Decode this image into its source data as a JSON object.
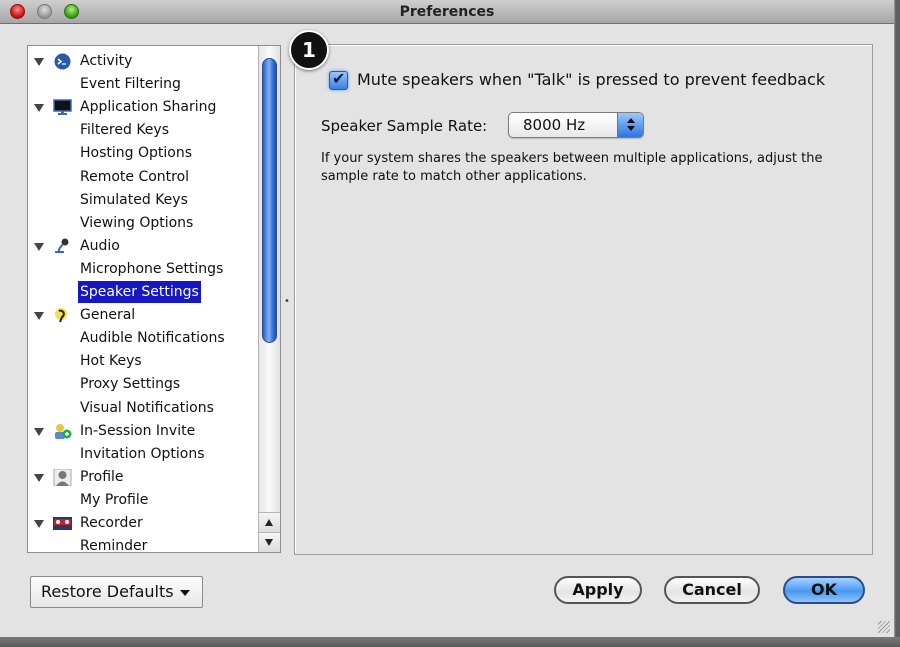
{
  "window": {
    "title": "Preferences"
  },
  "tree": {
    "items": [
      {
        "label": "Activity",
        "type": "parent",
        "icon": "activity-terminal-icon"
      },
      {
        "label": "Event Filtering",
        "type": "child"
      },
      {
        "label": "Application Sharing",
        "type": "parent",
        "icon": "monitor-icon"
      },
      {
        "label": "Filtered Keys",
        "type": "child"
      },
      {
        "label": "Hosting Options",
        "type": "child"
      },
      {
        "label": "Remote Control",
        "type": "child"
      },
      {
        "label": "Simulated Keys",
        "type": "child"
      },
      {
        "label": "Viewing Options",
        "type": "child"
      },
      {
        "label": "Audio",
        "type": "parent",
        "icon": "microphone-icon"
      },
      {
        "label": "Microphone Settings",
        "type": "child"
      },
      {
        "label": "Speaker Settings",
        "type": "child",
        "selected": true
      },
      {
        "label": "General",
        "type": "parent",
        "icon": "general-settings-icon"
      },
      {
        "label": "Audible Notifications",
        "type": "child"
      },
      {
        "label": "Hot Keys",
        "type": "child"
      },
      {
        "label": "Proxy Settings",
        "type": "child"
      },
      {
        "label": "Visual Notifications",
        "type": "child"
      },
      {
        "label": "In-Session Invite",
        "type": "parent",
        "icon": "invite-user-icon"
      },
      {
        "label": "Invitation Options",
        "type": "child"
      },
      {
        "label": "Profile",
        "type": "parent",
        "icon": "profile-silhouette-icon"
      },
      {
        "label": "My Profile",
        "type": "child"
      },
      {
        "label": "Recorder",
        "type": "parent",
        "icon": "recorder-icon"
      },
      {
        "label": "Reminder",
        "type": "child"
      }
    ],
    "selected": "Speaker Settings"
  },
  "callout": {
    "number": "1"
  },
  "speaker_settings": {
    "mute_label": "Mute speakers when \"Talk\" is pressed to prevent feedback",
    "mute_checked": true,
    "rate_label": "Speaker Sample Rate:",
    "rate_value": "8000 Hz",
    "help_text": "If your system shares the speakers between multiple applications, adjust the sample rate to match other applications."
  },
  "buttons": {
    "restore_defaults": "Restore Defaults",
    "apply": "Apply",
    "cancel": "Cancel",
    "ok": "OK"
  },
  "colors": {
    "selection": "#1717c4",
    "accent_blue": "#3c7fe0"
  }
}
